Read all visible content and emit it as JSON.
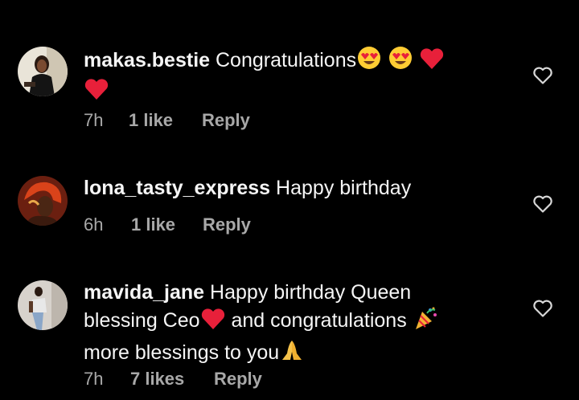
{
  "comments": [
    {
      "username": "makas.bestie",
      "text_before": "Congratulations",
      "emojis": [
        "heart-eyes",
        "heart-eyes",
        "red-heart",
        "red-heart"
      ],
      "time": "7h",
      "likes": "1 like",
      "reply_label": "Reply"
    },
    {
      "username": "lona_tasty_express",
      "text_before": "Happy birthday",
      "time": "6h",
      "likes": "1 like",
      "reply_label": "Reply"
    },
    {
      "username": "mavida_jane",
      "line1": "Happy birthday Queen",
      "line2_a": "blessing Ceo",
      "line2_b": "and congratulations",
      "line3": "more blessings to you",
      "emojis": [
        "red-heart",
        "party-popper",
        "folded-hands"
      ],
      "time": "7h",
      "likes": "7 likes",
      "reply_label": "Reply"
    }
  ],
  "colors": {
    "background": "#000000",
    "text": "#f5f5f5",
    "meta": "#a8a8a8",
    "heart": "#e8203a"
  }
}
